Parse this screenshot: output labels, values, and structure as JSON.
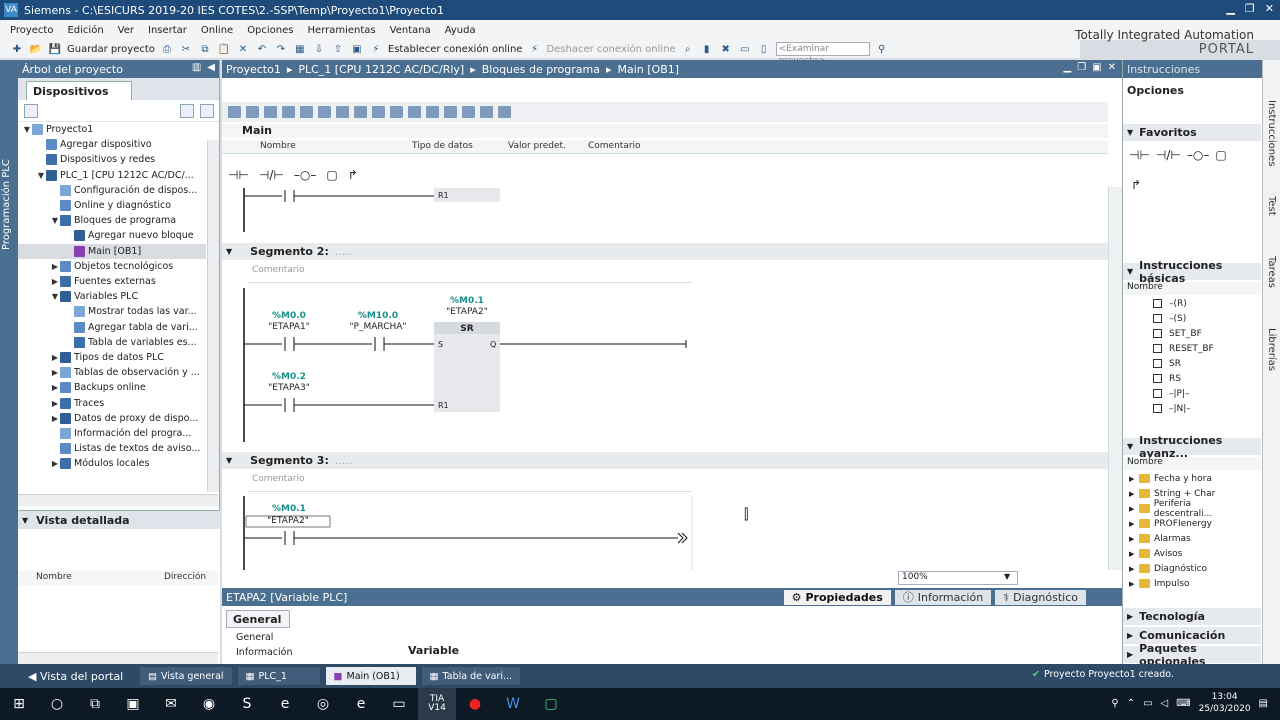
{
  "window": {
    "title": "Siemens - C:\\ESICURS 2019-20 IES COTES\\2.-SSP\\Temp\\Proyecto1\\Proyecto1",
    "app_logo_text": "VA"
  },
  "menu": [
    "Proyecto",
    "Edición",
    "Ver",
    "Insertar",
    "Online",
    "Opciones",
    "Herramientas",
    "Ventana",
    "Ayuda"
  ],
  "brand": {
    "line1": "Totally Integrated Automation",
    "line2": "PORTAL"
  },
  "toolbar": {
    "save_label": "Guardar proyecto",
    "connect_label": "Establecer conexión online",
    "disconnect_label": "Deshacer conexión online",
    "search_placeholder": "<Examinar proyecto>"
  },
  "left_strip_label": "Programación PLC",
  "project_tree": {
    "title": "Árbol del proyecto",
    "tab": "Dispositivos",
    "items": [
      {
        "label": "Proyecto1",
        "level": 0,
        "arrow": "▼"
      },
      {
        "label": "Agregar dispositivo",
        "level": 1,
        "arrow": ""
      },
      {
        "label": "Dispositivos y redes",
        "level": 1,
        "arrow": ""
      },
      {
        "label": "PLC_1 [CPU 1212C AC/DC/...",
        "level": 1,
        "arrow": "▼"
      },
      {
        "label": "Configuración de dispos...",
        "level": 2,
        "arrow": ""
      },
      {
        "label": "Online y diagnóstico",
        "level": 2,
        "arrow": ""
      },
      {
        "label": "Bloques de programa",
        "level": 2,
        "arrow": "▼"
      },
      {
        "label": "Agregar nuevo bloque",
        "level": 3,
        "arrow": ""
      },
      {
        "label": "Main [OB1]",
        "level": 3,
        "arrow": "",
        "selected": true
      },
      {
        "label": "Objetos tecnológicos",
        "level": 2,
        "arrow": "▶"
      },
      {
        "label": "Fuentes externas",
        "level": 2,
        "arrow": "▶"
      },
      {
        "label": "Variables PLC",
        "level": 2,
        "arrow": "▼"
      },
      {
        "label": "Mostrar todas las var...",
        "level": 3,
        "arrow": ""
      },
      {
        "label": "Agregar tabla de vari...",
        "level": 3,
        "arrow": ""
      },
      {
        "label": "Tabla de variables es...",
        "level": 3,
        "arrow": ""
      },
      {
        "label": "Tipos de datos PLC",
        "level": 2,
        "arrow": "▶"
      },
      {
        "label": "Tablas de observación y ...",
        "level": 2,
        "arrow": "▶"
      },
      {
        "label": "Backups online",
        "level": 2,
        "arrow": "▶"
      },
      {
        "label": "Traces",
        "level": 2,
        "arrow": "▶"
      },
      {
        "label": "Datos de proxy de dispo...",
        "level": 2,
        "arrow": "▶"
      },
      {
        "label": "Información del progra...",
        "level": 2,
        "arrow": ""
      },
      {
        "label": "Listas de textos de aviso...",
        "level": 2,
        "arrow": ""
      },
      {
        "label": "Módulos locales",
        "level": 2,
        "arrow": "▶"
      }
    ]
  },
  "detail_view": {
    "title": "Vista detallada",
    "col_name": "Nombre",
    "col_dir": "Dirección"
  },
  "editor": {
    "breadcrumb": [
      "Proyecto1",
      "PLC_1 [CPU 1212C AC/DC/Rly]",
      "Bloques de programa",
      "Main [OB1]"
    ],
    "interface_title": "Main",
    "interface_cols": [
      "Nombre",
      "Tipo de datos",
      "Valor predet.",
      "Comentario"
    ],
    "zoom": "100%",
    "seg1_reset_pin": "R1",
    "segment2": {
      "title": "Segmento 2:",
      "comment": "Comentario",
      "contact1_addr": "%M0.0",
      "contact1_name": "\"ETAPA1\"",
      "contact2_addr": "%M10.0",
      "contact2_name": "\"P_MARCHA\"",
      "box_addr": "%M0.1",
      "box_name": "\"ETAPA2\"",
      "box_type": "SR",
      "pin_s": "S",
      "pin_q": "Q",
      "pin_r1": "R1",
      "contact3_addr": "%M0.2",
      "contact3_name": "\"ETAPA3\""
    },
    "segment3": {
      "title": "Segmento 3:",
      "comment": "Comentario",
      "contact_addr": "%M0.1",
      "contact_name": "\"ETAPA2\""
    }
  },
  "properties": {
    "title": "ETAPA2 [Variable PLC]",
    "tabs": [
      "Propiedades",
      "Información",
      "Diagnóstico"
    ],
    "general_tab": "General",
    "nav": [
      "General",
      "Información"
    ],
    "section": "Variable"
  },
  "instructions": {
    "title": "Instrucciones",
    "options": "Opciones",
    "favorites": "Favoritos",
    "basic": "Instrucciones básicas",
    "basic_col": "Nombre",
    "basic_items": [
      "–(R)",
      "–(S)",
      "SET_BF",
      "RESET_BF",
      "SR",
      "RS",
      "–|P|–",
      "–|N|–"
    ],
    "advanced": "Instrucciones avanz...",
    "advanced_col": "Nombre",
    "advanced_items": [
      "Fecha y hora",
      "String + Char",
      "Periferia descentrali...",
      "PROFIenergy",
      "Alarmas",
      "Avisos",
      "Diagnóstico",
      "Impulso"
    ],
    "bottom_sections": [
      "Tecnología",
      "Comunicación",
      "Paquetes opcionales"
    ]
  },
  "right_strip": [
    "Instrucciones",
    "Test",
    "Tareas",
    "Librerías"
  ],
  "portal_bar": {
    "portal_view": "Vista del portal",
    "tasks": [
      "Vista general",
      "PLC_1",
      "Main (OB1)",
      "Tabla de vari..."
    ],
    "status": "Proyecto Proyecto1 creado."
  },
  "taskbar": {
    "tia_label": "TIA\nV14",
    "time": "13:04",
    "date": "25/03/2020"
  }
}
